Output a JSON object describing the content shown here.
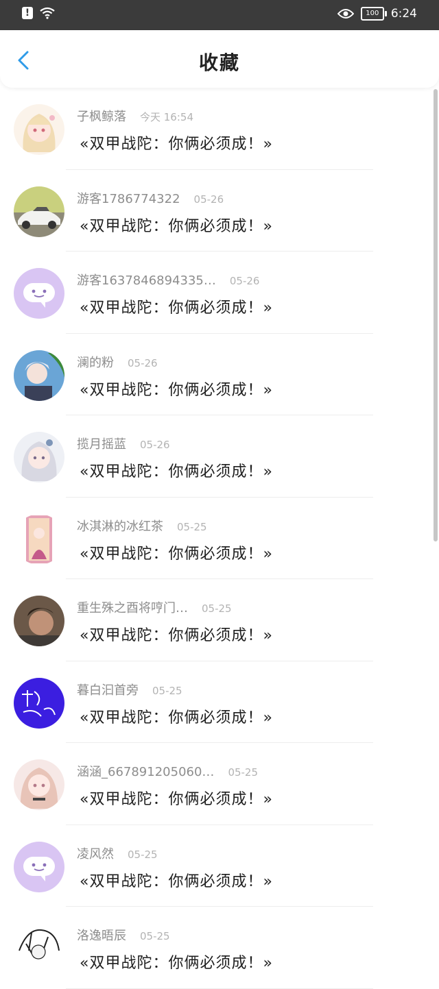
{
  "status_bar": {
    "time": "6:24",
    "battery": "100"
  },
  "header": {
    "title": "收藏",
    "back_icon": "chevron-left-icon"
  },
  "favorites": [
    {
      "username": "子枫鲸落",
      "time": "今天 16:54",
      "title": "«双甲战陀：你俩必须成！»",
      "avatar": "anime-girl-blonde"
    },
    {
      "username": "游客1786774322",
      "time": "05-26",
      "title": "«双甲战陀：你俩必须成！»",
      "avatar": "white-sports-car"
    },
    {
      "username": "游客1637846894335…",
      "time": "05-26",
      "title": "«双甲战陀：你俩必须成！»",
      "avatar": "default-chat-bubble"
    },
    {
      "username": "澜的粉",
      "time": "05-26",
      "title": "«双甲战陀：你俩必须成！»",
      "avatar": "game-character"
    },
    {
      "username": "揽月摇蓝",
      "time": "05-26",
      "title": "«双甲战陀：你俩必须成！»",
      "avatar": "anime-girl-silver"
    },
    {
      "username": "冰淇淋的冰红茶",
      "time": "05-25",
      "title": "«双甲战陀：你俩必须成！»",
      "avatar": "card-illustration"
    },
    {
      "username": "重生殊之酉将哼门…",
      "time": "05-25",
      "title": "«双甲战陀：你俩必须成！»",
      "avatar": "photo-man"
    },
    {
      "username": "暮白汩首旁",
      "time": "05-25",
      "title": "«双甲战陀：你俩必须成！»",
      "avatar": "handwriting-purple"
    },
    {
      "username": "涵涵_667891205060…",
      "time": "05-25",
      "title": "«双甲战陀：你俩必须成！»",
      "avatar": "anime-girl-pink"
    },
    {
      "username": "凌风然",
      "time": "05-25",
      "title": "«双甲战陀：你俩必须成！»",
      "avatar": "default-chat-bubble"
    },
    {
      "username": "洛逸晤辰",
      "time": "05-25",
      "title": "«双甲战陀：你俩必须成！»",
      "avatar": "manga-sketch"
    }
  ]
}
